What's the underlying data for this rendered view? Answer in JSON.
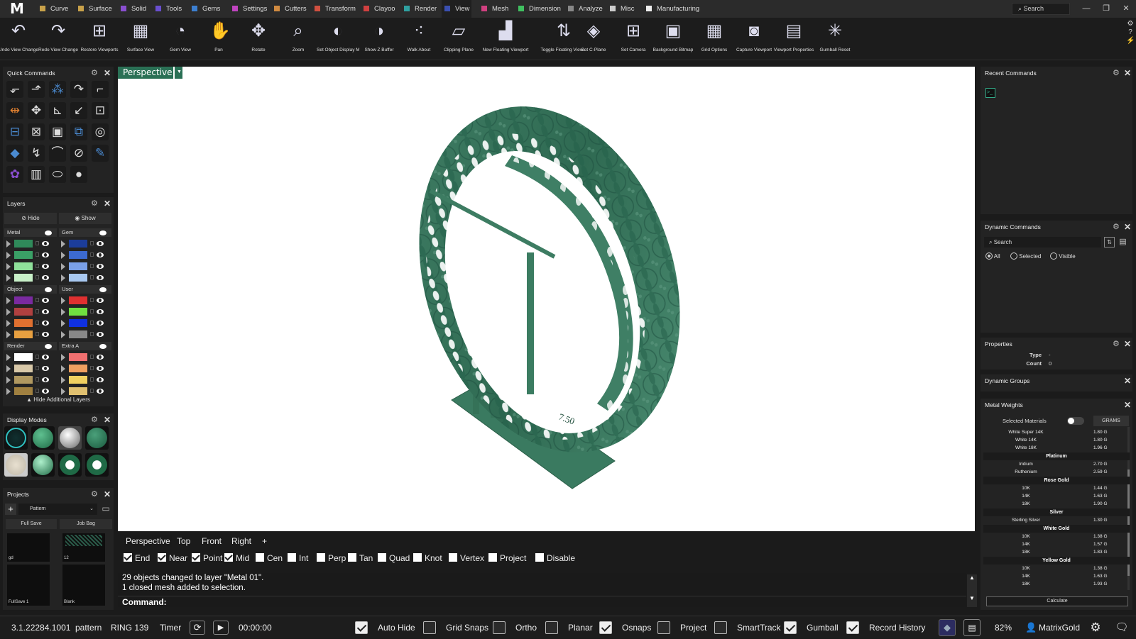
{
  "app": {
    "logo": "M"
  },
  "menu": {
    "tabs": [
      {
        "label": "Curve",
        "color": "#c9a24a"
      },
      {
        "label": "Surface",
        "color": "#c9a24a"
      },
      {
        "label": "Solid",
        "color": "#8a4fd0"
      },
      {
        "label": "Tools",
        "color": "#6a4fd0"
      },
      {
        "label": "Gems",
        "color": "#3c7fd0"
      },
      {
        "label": "Settings",
        "color": "#c044c0"
      },
      {
        "label": "Cutters",
        "color": "#d08a40"
      },
      {
        "label": "Transform",
        "color": "#d05040"
      },
      {
        "label": "Clayoo",
        "color": "#d04040"
      },
      {
        "label": "Render",
        "color": "#2fa0a0"
      },
      {
        "label": "View",
        "color": "#3a4fb0"
      },
      {
        "label": "Mesh",
        "color": "#d04080"
      },
      {
        "label": "Dimension",
        "color": "#40c060"
      },
      {
        "label": "Analyze",
        "color": "#888888"
      },
      {
        "label": "Misc",
        "color": "#cccccc"
      },
      {
        "label": "Manufacturing",
        "color": "#eeeeee"
      }
    ],
    "active": "View",
    "search": "Search"
  },
  "toolbar": {
    "items": [
      {
        "label": "Undo View Change",
        "icon": "undo-view-icon"
      },
      {
        "label": "Redo View Change",
        "icon": "redo-view-icon"
      },
      {
        "label": "Restore Viewports",
        "icon": "restore-viewports-icon"
      },
      {
        "label": "Surface View",
        "icon": "surface-view-icon"
      },
      {
        "label": "Gem View",
        "icon": "gem-view-icon"
      },
      {
        "label": "Pan",
        "icon": "hand-icon"
      },
      {
        "label": "Rotate",
        "icon": "rotate-icon"
      },
      {
        "label": "Zoom",
        "icon": "zoom-icon"
      },
      {
        "label": "Set Object Display M...",
        "icon": "display-mode-icon"
      },
      {
        "label": "Show Z Buffer",
        "icon": "z-buffer-icon"
      },
      {
        "label": "Walk About",
        "icon": "footprints-icon"
      },
      {
        "label": "Clipping Plane",
        "icon": "clipping-plane-icon"
      },
      {
        "label": "New Floating Viewport",
        "icon": "floating-viewport-icon"
      },
      {
        "label": "Toggle Floating View...",
        "icon": "toggle-floating-icon"
      },
      {
        "label": "Set C-Plane",
        "icon": "cplane-icon"
      },
      {
        "label": "Set Camera",
        "icon": "camera-grid-icon"
      },
      {
        "label": "Background Bitmap",
        "icon": "bitmap-icon"
      },
      {
        "label": "Grid Options",
        "icon": "grid-icon"
      },
      {
        "label": "Capture Viewport",
        "icon": "capture-icon"
      },
      {
        "label": "Viewport Properties",
        "icon": "viewport-properties-icon"
      },
      {
        "label": "Gumball Reset",
        "icon": "gumball-icon"
      }
    ]
  },
  "quick_commands": {
    "title": "Quick Commands"
  },
  "layers": {
    "title": "Layers",
    "hide": "Hide",
    "show": "Show",
    "hide_additional": "Hide Additional Layers",
    "groups": [
      {
        "name": "Metal",
        "colors": [
          "#2f8a5a",
          "#3aa066",
          "#8fe09a",
          "#c8f0c8"
        ]
      },
      {
        "name": "Gem",
        "colors": [
          "#1c3d9a",
          "#3c6ad0",
          "#7aa0e8",
          "#a8c8f0"
        ]
      },
      {
        "name": "Object",
        "colors": [
          "#7a2aa0",
          "#b04040",
          "#e07030",
          "#e8a040"
        ]
      },
      {
        "name": "User",
        "colors": [
          "#e03030",
          "#70e040",
          "#1030e0",
          "#888888"
        ]
      },
      {
        "name": "Render",
        "colors": [
          "#ffffff",
          "#d8c8a8",
          "#b09860",
          "#a08040"
        ]
      },
      {
        "name": "Extra A",
        "colors": [
          "#f07070",
          "#f0a060",
          "#f0d060",
          "#e0c070"
        ]
      }
    ]
  },
  "display_modes": {
    "title": "Display Modes"
  },
  "projects": {
    "title": "Projects",
    "pattern": "Pattern",
    "full_save": "Full Save",
    "job_bag": "Job Bag",
    "thumbs": [
      "gd",
      "12",
      "FullSave 1",
      "Blank"
    ]
  },
  "viewport": {
    "name": "Perspective",
    "engraving": "7.50",
    "tabs": [
      "Perspective",
      "Top",
      "Front",
      "Right",
      "+"
    ]
  },
  "osnaps": [
    {
      "label": "End",
      "on": true
    },
    {
      "label": "Near",
      "on": true
    },
    {
      "label": "Point",
      "on": true
    },
    {
      "label": "Mid",
      "on": true
    },
    {
      "label": "Cen",
      "on": false
    },
    {
      "label": "Int",
      "on": false
    },
    {
      "label": "Perp",
      "on": false
    },
    {
      "label": "Tan",
      "on": false
    },
    {
      "label": "Quad",
      "on": false
    },
    {
      "label": "Knot",
      "on": false
    },
    {
      "label": "Vertex",
      "on": false
    },
    {
      "label": "Project",
      "on": false
    },
    {
      "label": "Disable",
      "on": false
    }
  ],
  "command": {
    "history": [
      "29 objects changed to layer \"Metal 01\".",
      "1 closed mesh added to selection."
    ],
    "prompt": "Command:"
  },
  "recent_commands": {
    "title": "Recent Commands"
  },
  "dynamic_commands": {
    "title": "Dynamic Commands",
    "search": "Search",
    "filters": [
      "All",
      "Selected",
      "Visible"
    ]
  },
  "properties": {
    "title": "Properties",
    "type_label": "Type",
    "type_value": "-",
    "count_label": "Count",
    "count_value": "0"
  },
  "dynamic_groups": {
    "title": "Dynamic Groups"
  },
  "metal_weights": {
    "title": "Metal Weights",
    "selected_materials": "Selected Materials",
    "unit": "GRAMS",
    "calculate": "Calculate",
    "rows": [
      {
        "type": "item",
        "name": "White Super 14K",
        "value": "1.80 G"
      },
      {
        "type": "item",
        "name": "White 14K",
        "value": "1.80 G"
      },
      {
        "type": "item",
        "name": "White 18K",
        "value": "1.96 G"
      },
      {
        "type": "header",
        "name": "Platinum"
      },
      {
        "type": "item",
        "name": "Iridium",
        "value": "2.70 G"
      },
      {
        "type": "item",
        "name": "Ruthenium",
        "value": "2.59 G"
      },
      {
        "type": "header",
        "name": "Rose Gold"
      },
      {
        "type": "item",
        "name": "10K",
        "value": "1.44 G"
      },
      {
        "type": "item",
        "name": "14K",
        "value": "1.63 G"
      },
      {
        "type": "item",
        "name": "18K",
        "value": "1.90 G"
      },
      {
        "type": "header",
        "name": "Silver"
      },
      {
        "type": "item",
        "name": "Sterling Silver",
        "value": "1.30 G"
      },
      {
        "type": "header",
        "name": "White Gold"
      },
      {
        "type": "item",
        "name": "10K",
        "value": "1.38 G"
      },
      {
        "type": "item",
        "name": "14K",
        "value": "1.57 G"
      },
      {
        "type": "item",
        "name": "18K",
        "value": "1.83 G"
      },
      {
        "type": "header",
        "name": "Yellow Gold"
      },
      {
        "type": "item",
        "name": "10K",
        "value": "1.38 G"
      },
      {
        "type": "item",
        "name": "14K",
        "value": "1.63 G"
      },
      {
        "type": "item",
        "name": "18K",
        "value": "1.93 G"
      }
    ]
  },
  "status": {
    "version": "3.1.22284.1001",
    "file": "pattern",
    "layer": "RING 139",
    "timer": "Timer",
    "time": "00:00:00",
    "toggles": [
      {
        "label": "Auto Hide",
        "on": true
      },
      {
        "label": "Grid Snaps",
        "on": false
      },
      {
        "label": "Ortho",
        "on": false
      },
      {
        "label": "Planar",
        "on": false
      },
      {
        "label": "Osnaps",
        "on": true
      },
      {
        "label": "Project",
        "on": false
      },
      {
        "label": "SmartTrack",
        "on": false
      },
      {
        "label": "Gumball",
        "on": true
      },
      {
        "label": "Record History",
        "on": true
      }
    ],
    "zoom": "82%",
    "user": "MatrixGold"
  }
}
